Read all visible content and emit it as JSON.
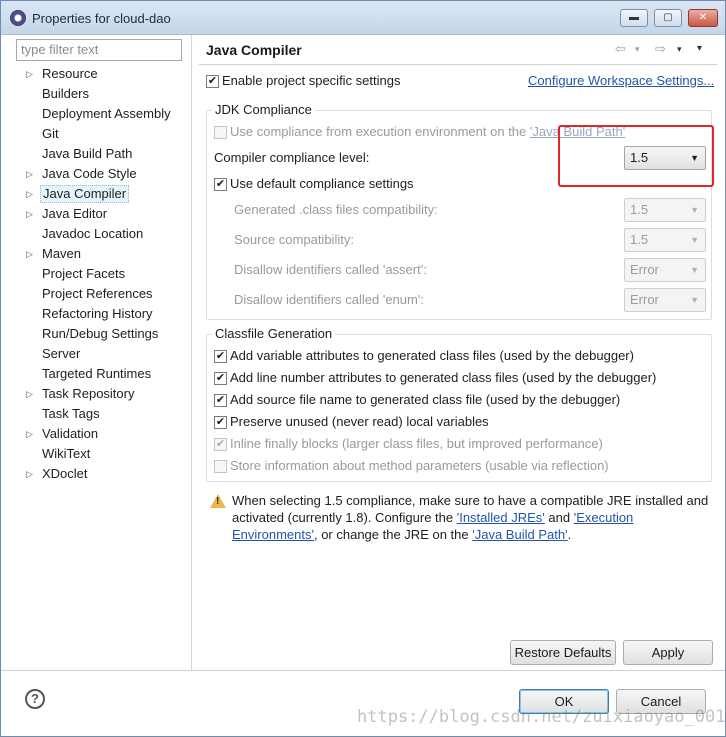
{
  "window": {
    "title": "Properties for cloud-dao",
    "controls": {
      "minimize": "▬",
      "maximize": "▢",
      "close": "✕"
    }
  },
  "sidebar": {
    "filter_placeholder": "type filter text",
    "items": [
      {
        "label": "Resource",
        "expandable": true
      },
      {
        "label": "Builders",
        "expandable": false
      },
      {
        "label": "Deployment Assembly",
        "expandable": false
      },
      {
        "label": "Git",
        "expandable": false
      },
      {
        "label": "Java Build Path",
        "expandable": false
      },
      {
        "label": "Java Code Style",
        "expandable": true
      },
      {
        "label": "Java Compiler",
        "expandable": true,
        "selected": true
      },
      {
        "label": "Java Editor",
        "expandable": true
      },
      {
        "label": "Javadoc Location",
        "expandable": false
      },
      {
        "label": "Maven",
        "expandable": true
      },
      {
        "label": "Project Facets",
        "expandable": false
      },
      {
        "label": "Project References",
        "expandable": false
      },
      {
        "label": "Refactoring History",
        "expandable": false
      },
      {
        "label": "Run/Debug Settings",
        "expandable": false
      },
      {
        "label": "Server",
        "expandable": false
      },
      {
        "label": "Targeted Runtimes",
        "expandable": false
      },
      {
        "label": "Task Repository",
        "expandable": true
      },
      {
        "label": "Task Tags",
        "expandable": false
      },
      {
        "label": "Validation",
        "expandable": true
      },
      {
        "label": "WikiText",
        "expandable": false
      },
      {
        "label": "XDoclet",
        "expandable": true
      }
    ]
  },
  "page": {
    "title": "Java Compiler",
    "nav_icons": {
      "back": "⇦",
      "back_menu": "▾",
      "forward": "⇨",
      "forward_menu": "▾",
      "menu": "▾"
    },
    "enable_project_specific": {
      "label": "Enable project specific settings",
      "checked": true
    },
    "configure_workspace_link": "Configure Workspace Settings...",
    "jdk": {
      "group_title": "JDK Compliance",
      "use_exec_env": {
        "label_prefix": "Use compliance from execution environment on the ",
        "link": "'Java Build Path'",
        "checked": false,
        "enabled": false
      },
      "compliance_level": {
        "label": "Compiler compliance level:",
        "value": "1.5"
      },
      "use_default": {
        "label": "Use default compliance settings",
        "checked": true
      },
      "settings": [
        {
          "label": "Generated .class files compatibility:",
          "value": "1.5"
        },
        {
          "label": "Source compatibility:",
          "value": "1.5"
        },
        {
          "label": "Disallow identifiers called 'assert':",
          "value": "Error"
        },
        {
          "label": "Disallow identifiers called 'enum':",
          "value": "Error"
        }
      ]
    },
    "classfile": {
      "group_title": "Classfile Generation",
      "options": [
        {
          "label": "Add variable attributes to generated class files (used by the debugger)",
          "checked": true,
          "enabled": true
        },
        {
          "label": "Add line number attributes to generated class files (used by the debugger)",
          "checked": true,
          "enabled": true
        },
        {
          "label": "Add source file name to generated class file (used by the debugger)",
          "checked": true,
          "enabled": true
        },
        {
          "label": "Preserve unused (never read) local variables",
          "checked": true,
          "enabled": true
        },
        {
          "label": "Inline finally blocks (larger class files, but improved performance)",
          "checked": true,
          "enabled": false
        },
        {
          "label": "Store information about method parameters (usable via reflection)",
          "checked": false,
          "enabled": false
        }
      ]
    },
    "warning": {
      "line1": "When selecting 1.5 compliance, make sure to have a compatible JRE installed and",
      "line2_a": "activated (currently 1.8). Configure the ",
      "link_installed_jres": "'Installed JREs'",
      "line2_b": " and ",
      "link_exec_env_1": "'Execution",
      "link_exec_env_2": "Environments'",
      "line3_a": ", or change the JRE on the ",
      "link_build_path": "'Java Build Path'",
      "line3_b": "."
    },
    "restore_defaults": "Restore Defaults",
    "apply": "Apply"
  },
  "footer": {
    "help": "?",
    "ok": "OK",
    "cancel": "Cancel"
  },
  "watermark": "https://blog.csdn.net/zuixiaoyao_001",
  "colors": {
    "highlight": "#e4242b",
    "link": "#2255aa"
  }
}
